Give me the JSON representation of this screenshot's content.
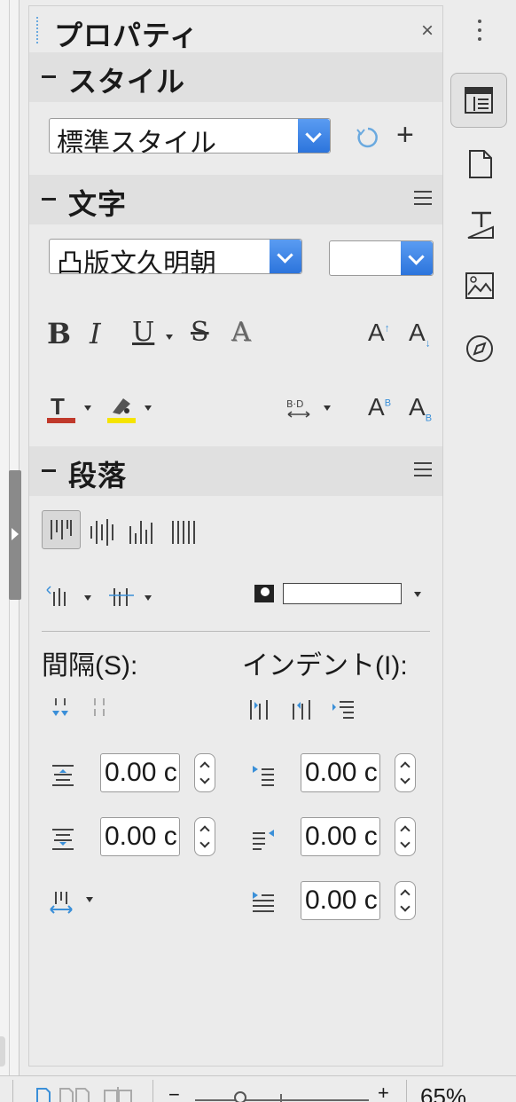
{
  "panel": {
    "title": "プロパティ",
    "close": "×"
  },
  "style_section": {
    "title": "スタイル",
    "style_value": "標準スタイル",
    "add": "+"
  },
  "character_section": {
    "title": "文字",
    "font_name": "凸版文久明朝",
    "font_size": "",
    "bold": "B",
    "italic": "I",
    "underline": "U",
    "strikethrough": "S",
    "shadow": "A",
    "grow": "A",
    "shrink": "A",
    "superscript": "A",
    "subscript": "A"
  },
  "paragraph_section": {
    "title": "段落",
    "spacing_label": "間隔(S):",
    "indent_label": "インデント(I):",
    "above_spacing": "0.00 c",
    "below_spacing": "0.00 c",
    "before_indent": "0.00 c",
    "after_indent": "0.00 c",
    "first_line_indent": "0.00 c"
  },
  "statusbar": {
    "zoom_minus": "−",
    "zoom_plus": "+",
    "zoom_percent": "65%"
  },
  "colors": {
    "accent": "#2c74dc",
    "font_color": "#c0392b",
    "highlight": "#f5e400"
  }
}
